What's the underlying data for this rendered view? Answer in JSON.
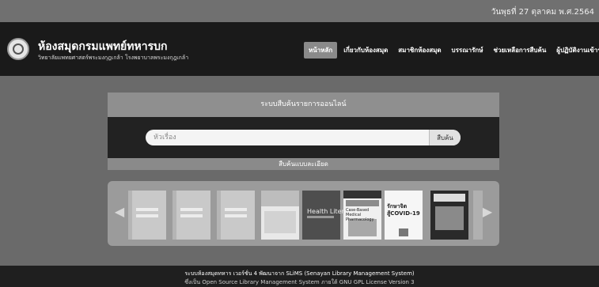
{
  "topbar": {
    "date": "วันพุธที่ 27 ตุลาคม พ.ศ.2564"
  },
  "header": {
    "title": "ห้องสมุดกรมแพทย์ทหารบก",
    "subtitle": "วิทยาลัยแพทยศาสตร์พระมงกุฎเกล้า โรงพยาบาลพระมงกุฎเกล้า"
  },
  "nav": {
    "items": [
      {
        "label": "หน้าหลัก",
        "active": true
      },
      {
        "label": "เกี่ยวกับห้องสมุด"
      },
      {
        "label": "สมาชิกห้องสมุด"
      },
      {
        "label": "บรรณารักษ์"
      },
      {
        "label": "ช่วยเหลือการสืบค้น"
      },
      {
        "label": "ผู้ปฏิบัติงานเข้าระบบ"
      }
    ]
  },
  "search": {
    "heading": "ระบบสืบค้นรายการออนไลน์",
    "placeholder": "หัวเรื่อง",
    "button": "สืบค้น",
    "advanced": "สืบค้นแบบละเอียด"
  },
  "shelf": {
    "books": [
      {
        "title": "Health Literacy"
      },
      {
        "title": "Case-Based Medical Pharmacology"
      },
      {
        "title": "รักษาจิต สู้COVID-19"
      }
    ]
  },
  "footer": {
    "line1": "ระบบห้องสมุดทหาร เวอร์ชั่น 4 พัฒนาจาก SLiMS (Senayan Library Management System)",
    "line2": "ซึ่งเป็น Open Source Library Management System ภายใต้ GNU GPL License Version 3"
  }
}
